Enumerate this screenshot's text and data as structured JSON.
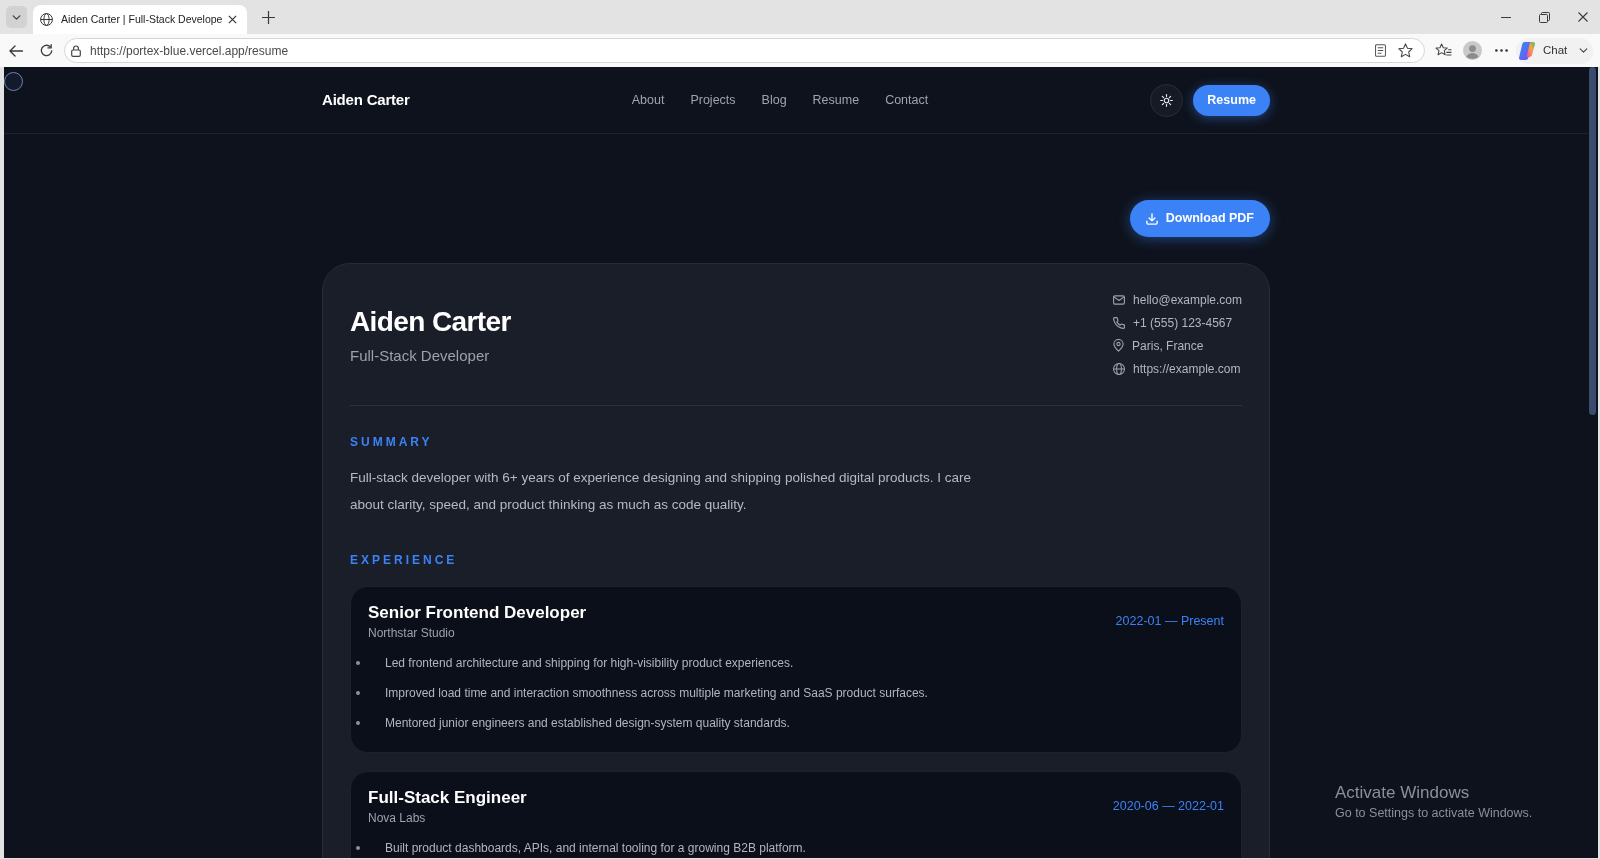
{
  "browser": {
    "tab_title": "Aiden Carter | Full-Stack Develope",
    "url": "https://portex-blue.vercel.app/resume",
    "chat_button": "Chat"
  },
  "navbar": {
    "brand": "Aiden Carter",
    "links": [
      "About",
      "Projects",
      "Blog",
      "Resume",
      "Contact"
    ],
    "cta": "Resume"
  },
  "download_button": "Download PDF",
  "resume": {
    "name": "Aiden Carter",
    "role": "Full-Stack Developer",
    "contacts": [
      {
        "kind": "email",
        "text": "hello@example.com"
      },
      {
        "kind": "phone",
        "text": "+1 (555) 123-4567"
      },
      {
        "kind": "location",
        "text": "Paris, France"
      },
      {
        "kind": "website",
        "text": "https://example.com"
      }
    ],
    "summary": {
      "heading": "SUMMARY",
      "text": "Full-stack developer with 6+ years of experience designing and shipping polished digital products. I care about clarity, speed, and product thinking as much as code quality."
    },
    "experience": {
      "heading": "EXPERIENCE",
      "jobs": [
        {
          "title": "Senior Frontend Developer",
          "company": "Northstar Studio",
          "dates": "2022-01 — Present",
          "bullets": [
            "Led frontend architecture and shipping for high-visibility product experiences.",
            "Improved load time and interaction smoothness across multiple marketing and SaaS product surfaces.",
            "Mentored junior engineers and established design-system quality standards."
          ]
        },
        {
          "title": "Full-Stack Engineer",
          "company": "Nova Labs",
          "dates": "2020-06 — 2022-01",
          "bullets": [
            "Built product dashboards, APIs, and internal tooling for a growing B2B platform."
          ]
        }
      ]
    }
  },
  "os_notice": {
    "title": "Activate Windows",
    "text": "Go to Settings to activate Windows."
  }
}
